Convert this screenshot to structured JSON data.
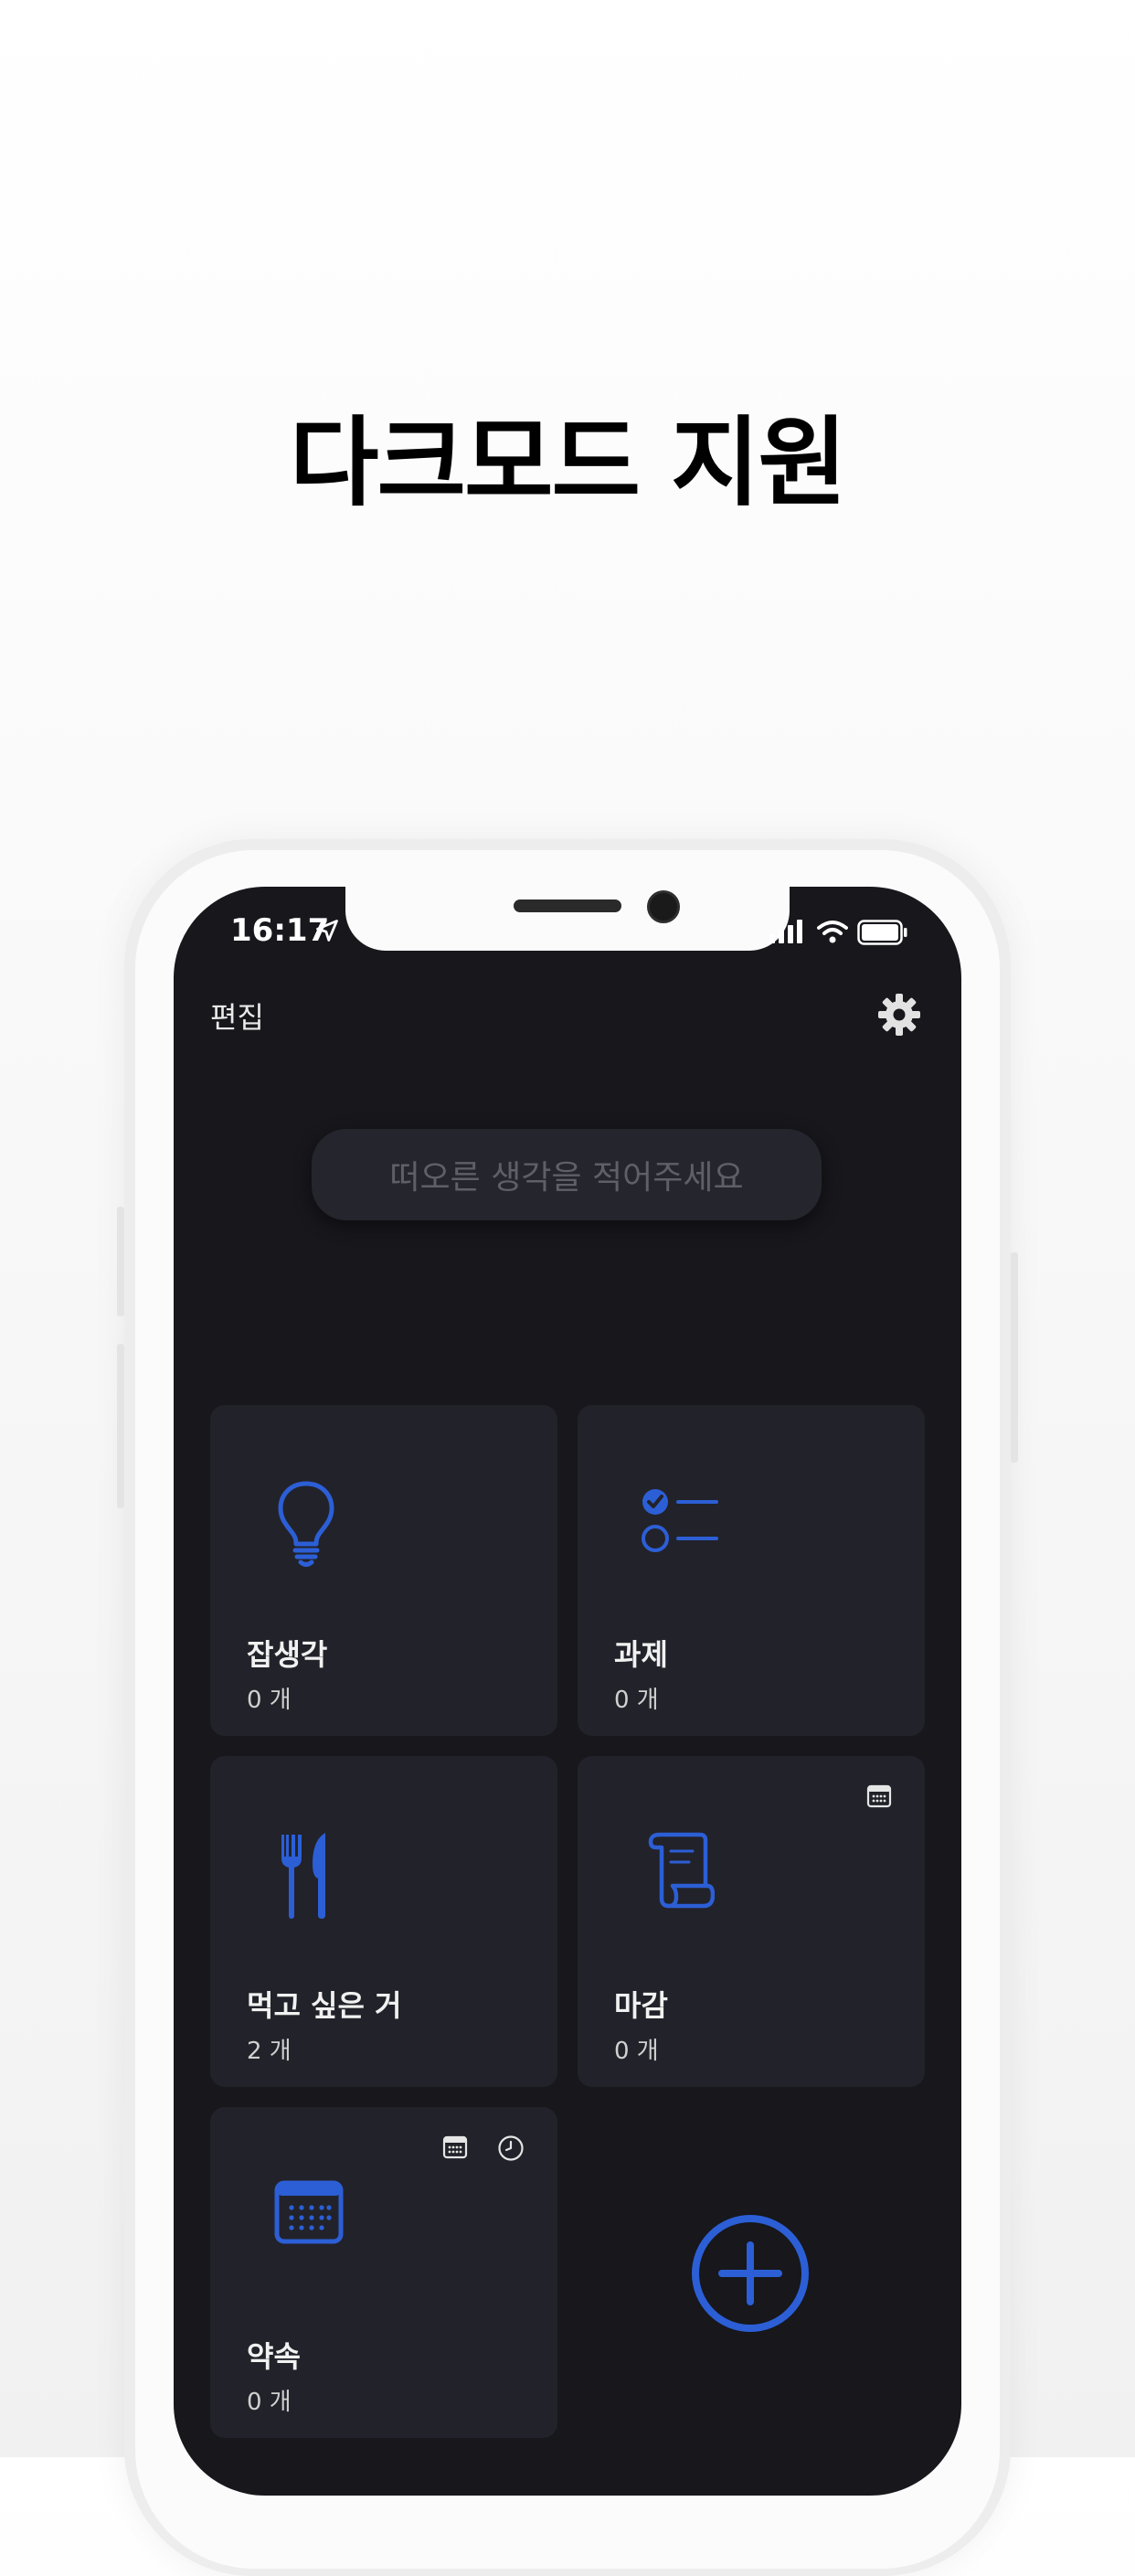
{
  "headline": "다크모드 지원",
  "status_bar": {
    "time": "16:17"
  },
  "nav": {
    "edit_label": "편집"
  },
  "input": {
    "placeholder": "떠오른 생각을 적어주세요"
  },
  "cards": [
    {
      "title": "잡생각",
      "count": "0 개",
      "icon": "lightbulb-icon"
    },
    {
      "title": "과제",
      "count": "0 개",
      "icon": "checklist-icon"
    },
    {
      "title": "먹고 싶은 거",
      "count": "2 개",
      "icon": "fork-knife-icon"
    },
    {
      "title": "마감",
      "count": "0 개",
      "icon": "scroll-icon",
      "badges": [
        "calendar-icon"
      ]
    },
    {
      "title": "약속",
      "count": "0 개",
      "icon": "calendar-icon",
      "badges": [
        "calendar-icon",
        "clock-icon"
      ]
    }
  ],
  "colors": {
    "accent": "#2c5fd6",
    "screen_bg": "#17171c",
    "card_bg": "#22222a"
  }
}
